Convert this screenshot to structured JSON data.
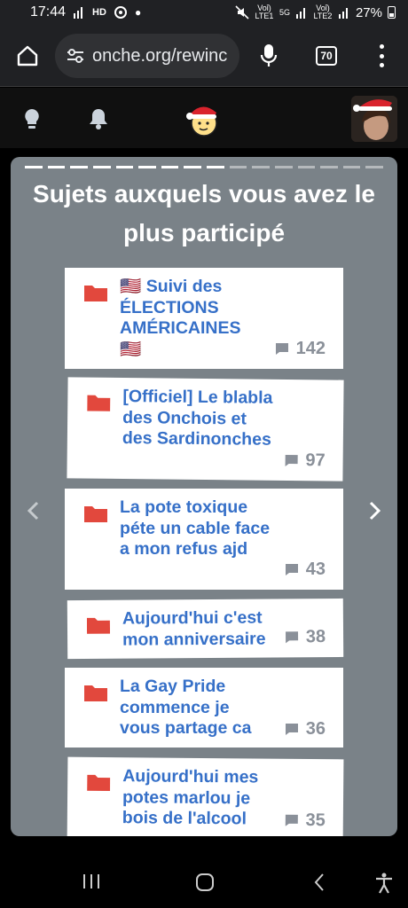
{
  "status": {
    "time": "17:44",
    "net_left": "Voỉ) LTE1",
    "net_5g": "5G",
    "net_right": "Voỉ) LTE2",
    "battery": "27%"
  },
  "browser": {
    "url": "onche.org/rewinc",
    "tab_count": "70"
  },
  "card": {
    "title": "Sujets auxquels vous avez le plus participé",
    "progress_total": 16,
    "progress_done": 9
  },
  "topics": [
    {
      "prefix": "🇺🇸",
      "title": "Suivi des ÉLECTIONS AMÉRICAINES",
      "suffix": "🇺🇸",
      "count": "142"
    },
    {
      "title": "[Officiel] Le blabla des Onchois et des Sardinonches",
      "count": "97"
    },
    {
      "title": "La pote toxique péte un cable face a mon refus ajd",
      "count": "43"
    },
    {
      "title": "Aujourd'hui c'est mon anniversaire",
      "count": "38"
    },
    {
      "title": "La Gay Pride commence je vous partage ca",
      "count": "36"
    },
    {
      "title": "Aujourd'hui mes potes marlou je bois de l'alcool",
      "count": "35"
    }
  ],
  "colors": {
    "card_bg": "#7a8288",
    "topic_title": "#3670c8",
    "folder": "#e2483d",
    "count": "#8a9099"
  }
}
